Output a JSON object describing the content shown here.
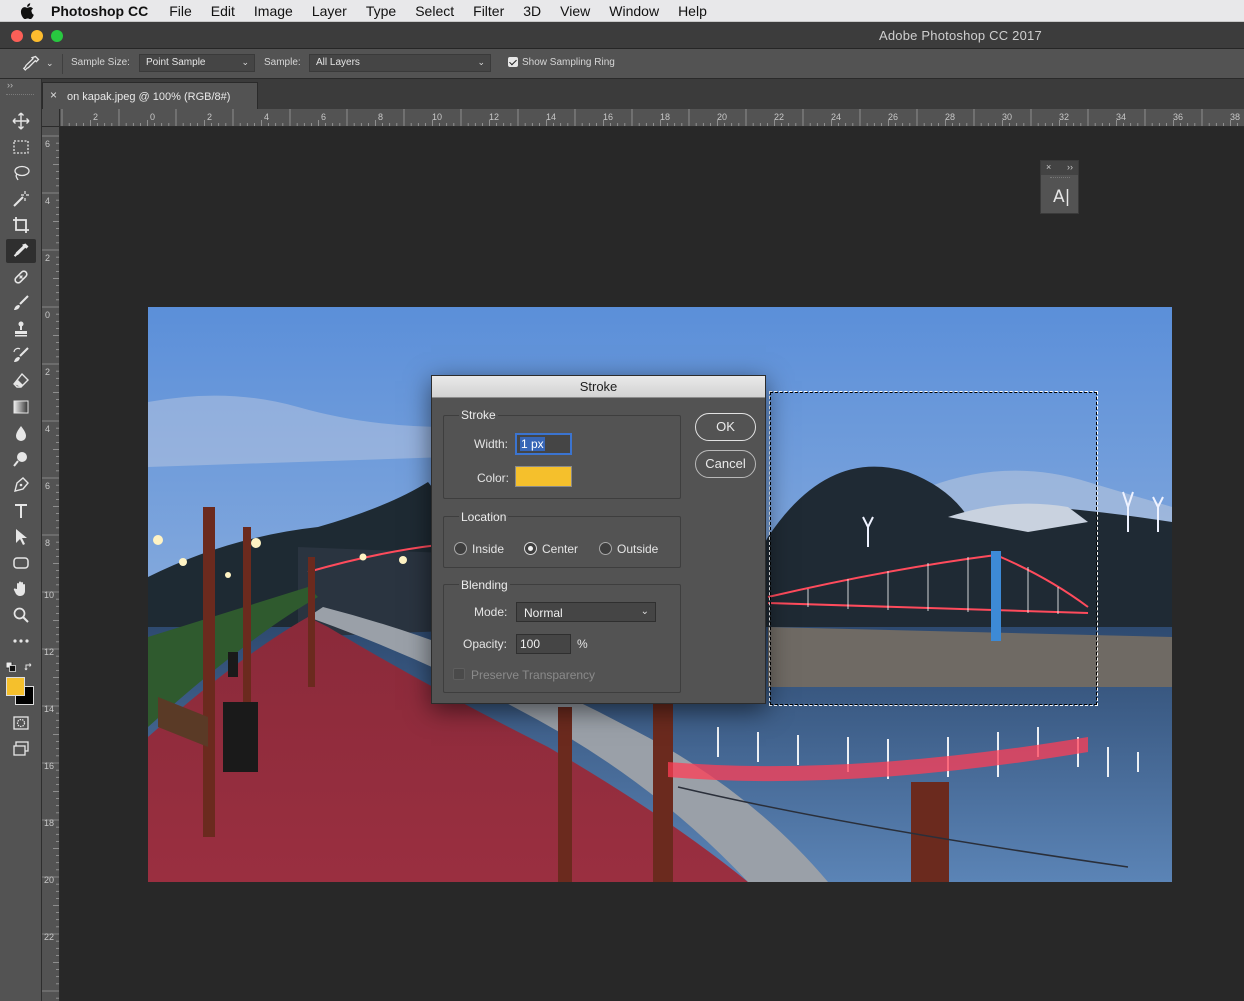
{
  "menubar": {
    "apple_icon": "apple-logo",
    "app_name": "Photoshop CC",
    "items": [
      "File",
      "Edit",
      "Image",
      "Layer",
      "Type",
      "Select",
      "Filter",
      "3D",
      "View",
      "Window",
      "Help"
    ]
  },
  "window": {
    "title": "Adobe Photoshop CC 2017"
  },
  "options_bar": {
    "tool_icon": "eyedropper-icon",
    "sample_size_label": "Sample Size:",
    "sample_size_value": "Point Sample",
    "sample_label": "Sample:",
    "sample_value": "All Layers",
    "show_ring_label": "Show Sampling Ring",
    "show_ring_checked": true
  },
  "document_tab": {
    "title": "on kapak.jpeg @ 100% (RGB/8#)",
    "close": "×"
  },
  "rulers": {
    "top": [
      "2",
      "0",
      "2",
      "4",
      "6",
      "8",
      "10",
      "12",
      "14",
      "16",
      "18",
      "20",
      "22",
      "24",
      "26",
      "28",
      "30",
      "32",
      "34",
      "36",
      "38"
    ],
    "left": [
      "6",
      "4",
      "2",
      "0",
      "2",
      "4",
      "6",
      "8",
      "10",
      "12",
      "14",
      "16",
      "18",
      "20",
      "22"
    ]
  },
  "toolbox": {
    "collapse": "››",
    "active_tool": "eyedropper-icon",
    "foreground_color": "#f5c02c",
    "background_color": "#000000",
    "tools": [
      "move-icon",
      "marquee-icon",
      "lasso-icon",
      "magic-wand-icon",
      "crop-icon",
      "eyedropper-icon",
      "healing-brush-icon",
      "brush-icon",
      "stamp-icon",
      "history-brush-icon",
      "eraser-icon",
      "gradient-icon",
      "blur-icon",
      "dodge-icon",
      "pen-icon",
      "type-icon",
      "path-selection-icon",
      "shape-icon",
      "hand-icon",
      "zoom-icon",
      "more-tools-icon"
    ]
  },
  "mini_panel": {
    "close": "×",
    "expand": "››",
    "icon_text": "A|"
  },
  "dialog": {
    "title": "Stroke",
    "stroke_section": "Stroke",
    "width_label": "Width:",
    "width_value": "1 px",
    "color_label": "Color:",
    "color_value": "#f5c02c",
    "location_section": "Location",
    "location_options": [
      "Inside",
      "Center",
      "Outside"
    ],
    "location_selected": "Center",
    "blending_section": "Blending",
    "mode_label": "Mode:",
    "mode_value": "Normal",
    "opacity_label": "Opacity:",
    "opacity_value": "100",
    "opacity_unit": "%",
    "preserve_label": "Preserve Transparency",
    "preserve_checked": false,
    "ok_label": "OK",
    "cancel_label": "Cancel"
  }
}
